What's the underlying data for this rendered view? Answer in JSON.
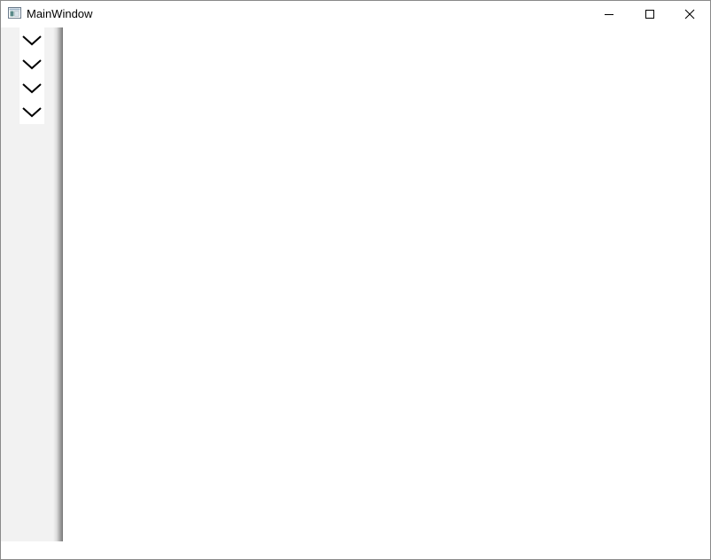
{
  "window": {
    "title": "MainWindow",
    "app_icon": "app-window-icon",
    "controls": {
      "minimize_icon": "minimize-icon",
      "maximize_icon": "maximize-icon",
      "close_icon": "close-icon"
    }
  },
  "sidebar": {
    "background": "#f2f2f2",
    "items": [
      {
        "icon": "chevron-down-icon"
      },
      {
        "icon": "chevron-down-icon"
      },
      {
        "icon": "chevron-down-icon"
      },
      {
        "icon": "chevron-down-icon"
      }
    ]
  },
  "content": {
    "background": "#ffffff"
  }
}
